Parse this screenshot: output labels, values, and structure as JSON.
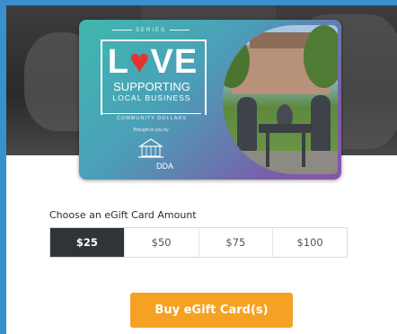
{
  "card": {
    "series": "SERIES",
    "love_prefix": "L",
    "love_suffix": "VE",
    "heart_glyph": "♥",
    "supporting": "SUPPORTING",
    "local_business": "LOCAL BUSINESS",
    "community_dollars": "COMMUNITY DOLLARS",
    "brought_to_you_by": "Brought to you by",
    "dda": "DDA",
    "colors": {
      "gradient_start": "#3fb8ad",
      "gradient_end": "#8a55a6",
      "heart": "#e5342e"
    }
  },
  "amount": {
    "label": "Choose an eGift Card Amount",
    "options": [
      "$25",
      "$50",
      "$75",
      "$100"
    ],
    "selected": "$25"
  },
  "buy_button": {
    "label": "Buy eGift Card(s)",
    "color": "#f4a124"
  },
  "colors": {
    "frame_border": "#3a8fcf",
    "selected_amount_bg": "#2f3438"
  }
}
